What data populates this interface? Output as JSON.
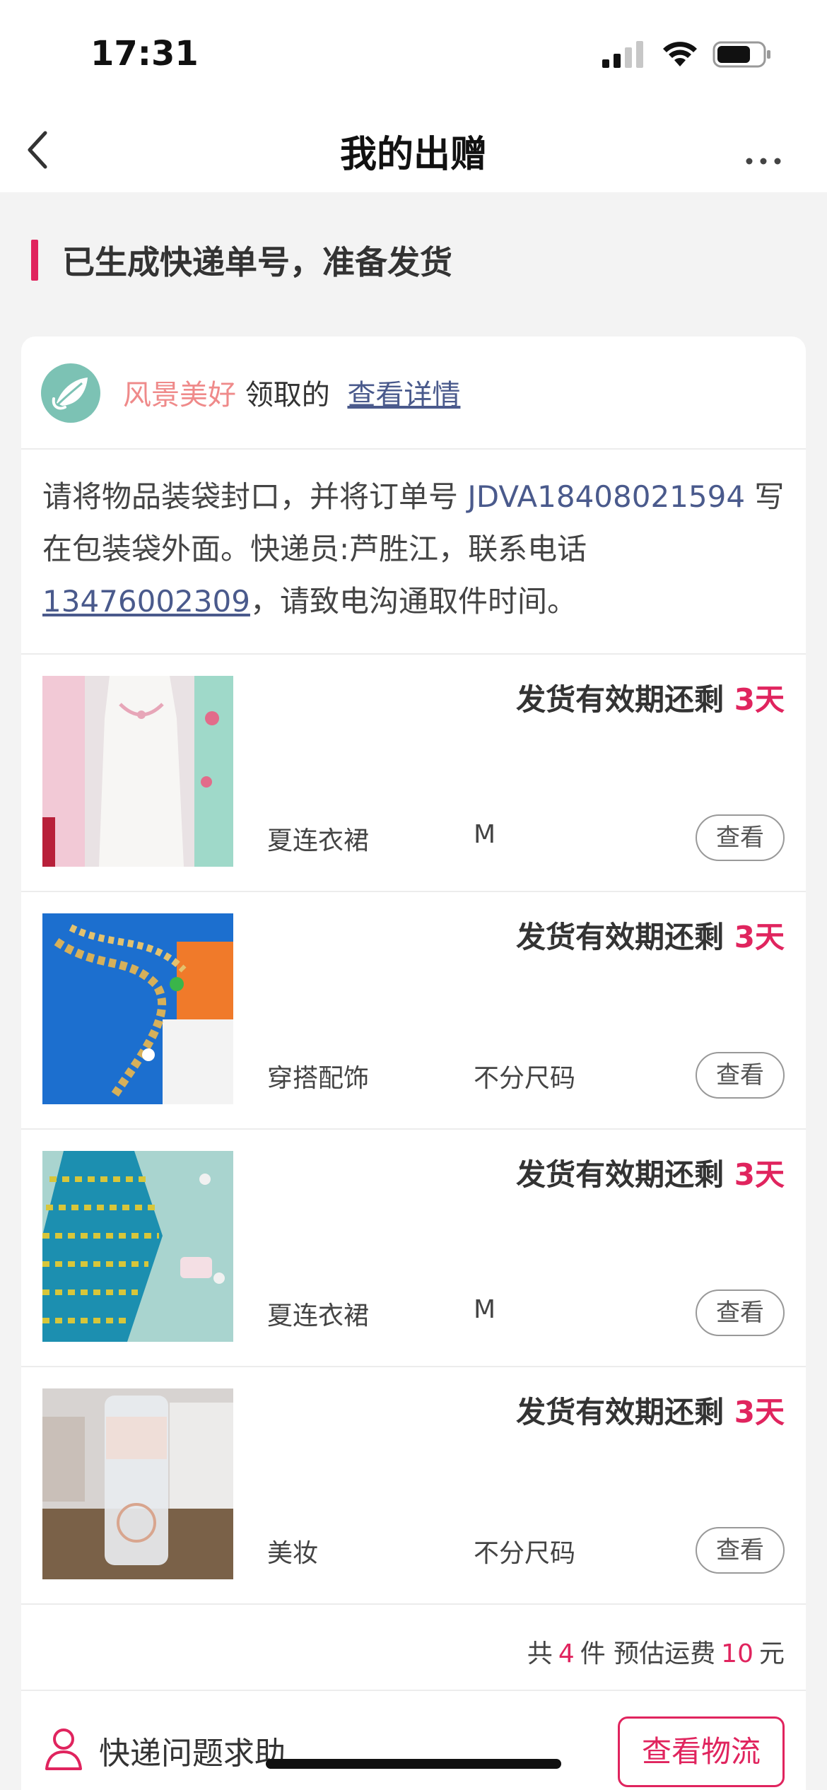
{
  "status_bar": {
    "time": "17:31"
  },
  "nav": {
    "title": "我的出赠"
  },
  "section": {
    "title": "已生成快递单号，准备发货"
  },
  "receiver": {
    "name": "风景美好",
    "action": "领取的",
    "detail_link": "查看详情"
  },
  "instruction": {
    "prefix": "请将物品装袋封口，并将订单号 ",
    "order_no": "JDVA18408021594",
    "middle": " 写在包装袋外面。快递员:芦胜江，联系电话",
    "phone": "13476002309",
    "suffix": "，请致电沟通取件时间。"
  },
  "items": [
    {
      "deadline_prefix": "发货有效期还剩 ",
      "deadline_days": "3天",
      "category": "夏连衣裙",
      "size": "M",
      "view_label": "查看",
      "image": "white-dress-photo"
    },
    {
      "deadline_prefix": "发货有效期还剩 ",
      "deadline_days": "3天",
      "category": "穿搭配饰",
      "size": "不分尺码",
      "view_label": "查看",
      "image": "gold-chain-photo"
    },
    {
      "deadline_prefix": "发货有效期还剩 ",
      "deadline_days": "3天",
      "category": "夏连衣裙",
      "size": "M",
      "view_label": "查看",
      "image": "blue-dress-photo"
    },
    {
      "deadline_prefix": "发货有效期还剩 ",
      "deadline_days": "3天",
      "category": "美妆",
      "size": "不分尺码",
      "view_label": "查看",
      "image": "toner-bottle-photo"
    }
  ],
  "summary": {
    "prefix": "共",
    "count": "4",
    "middle": "件 预估运费",
    "fee": "10",
    "suffix": "元"
  },
  "help": {
    "label": "快递问题求助",
    "logistics_button": "查看物流"
  },
  "colors": {
    "accent": "#e0245e",
    "link": "#4a5a8c",
    "receiver_name": "#ef8a8a",
    "background": "#f3f3f3"
  }
}
